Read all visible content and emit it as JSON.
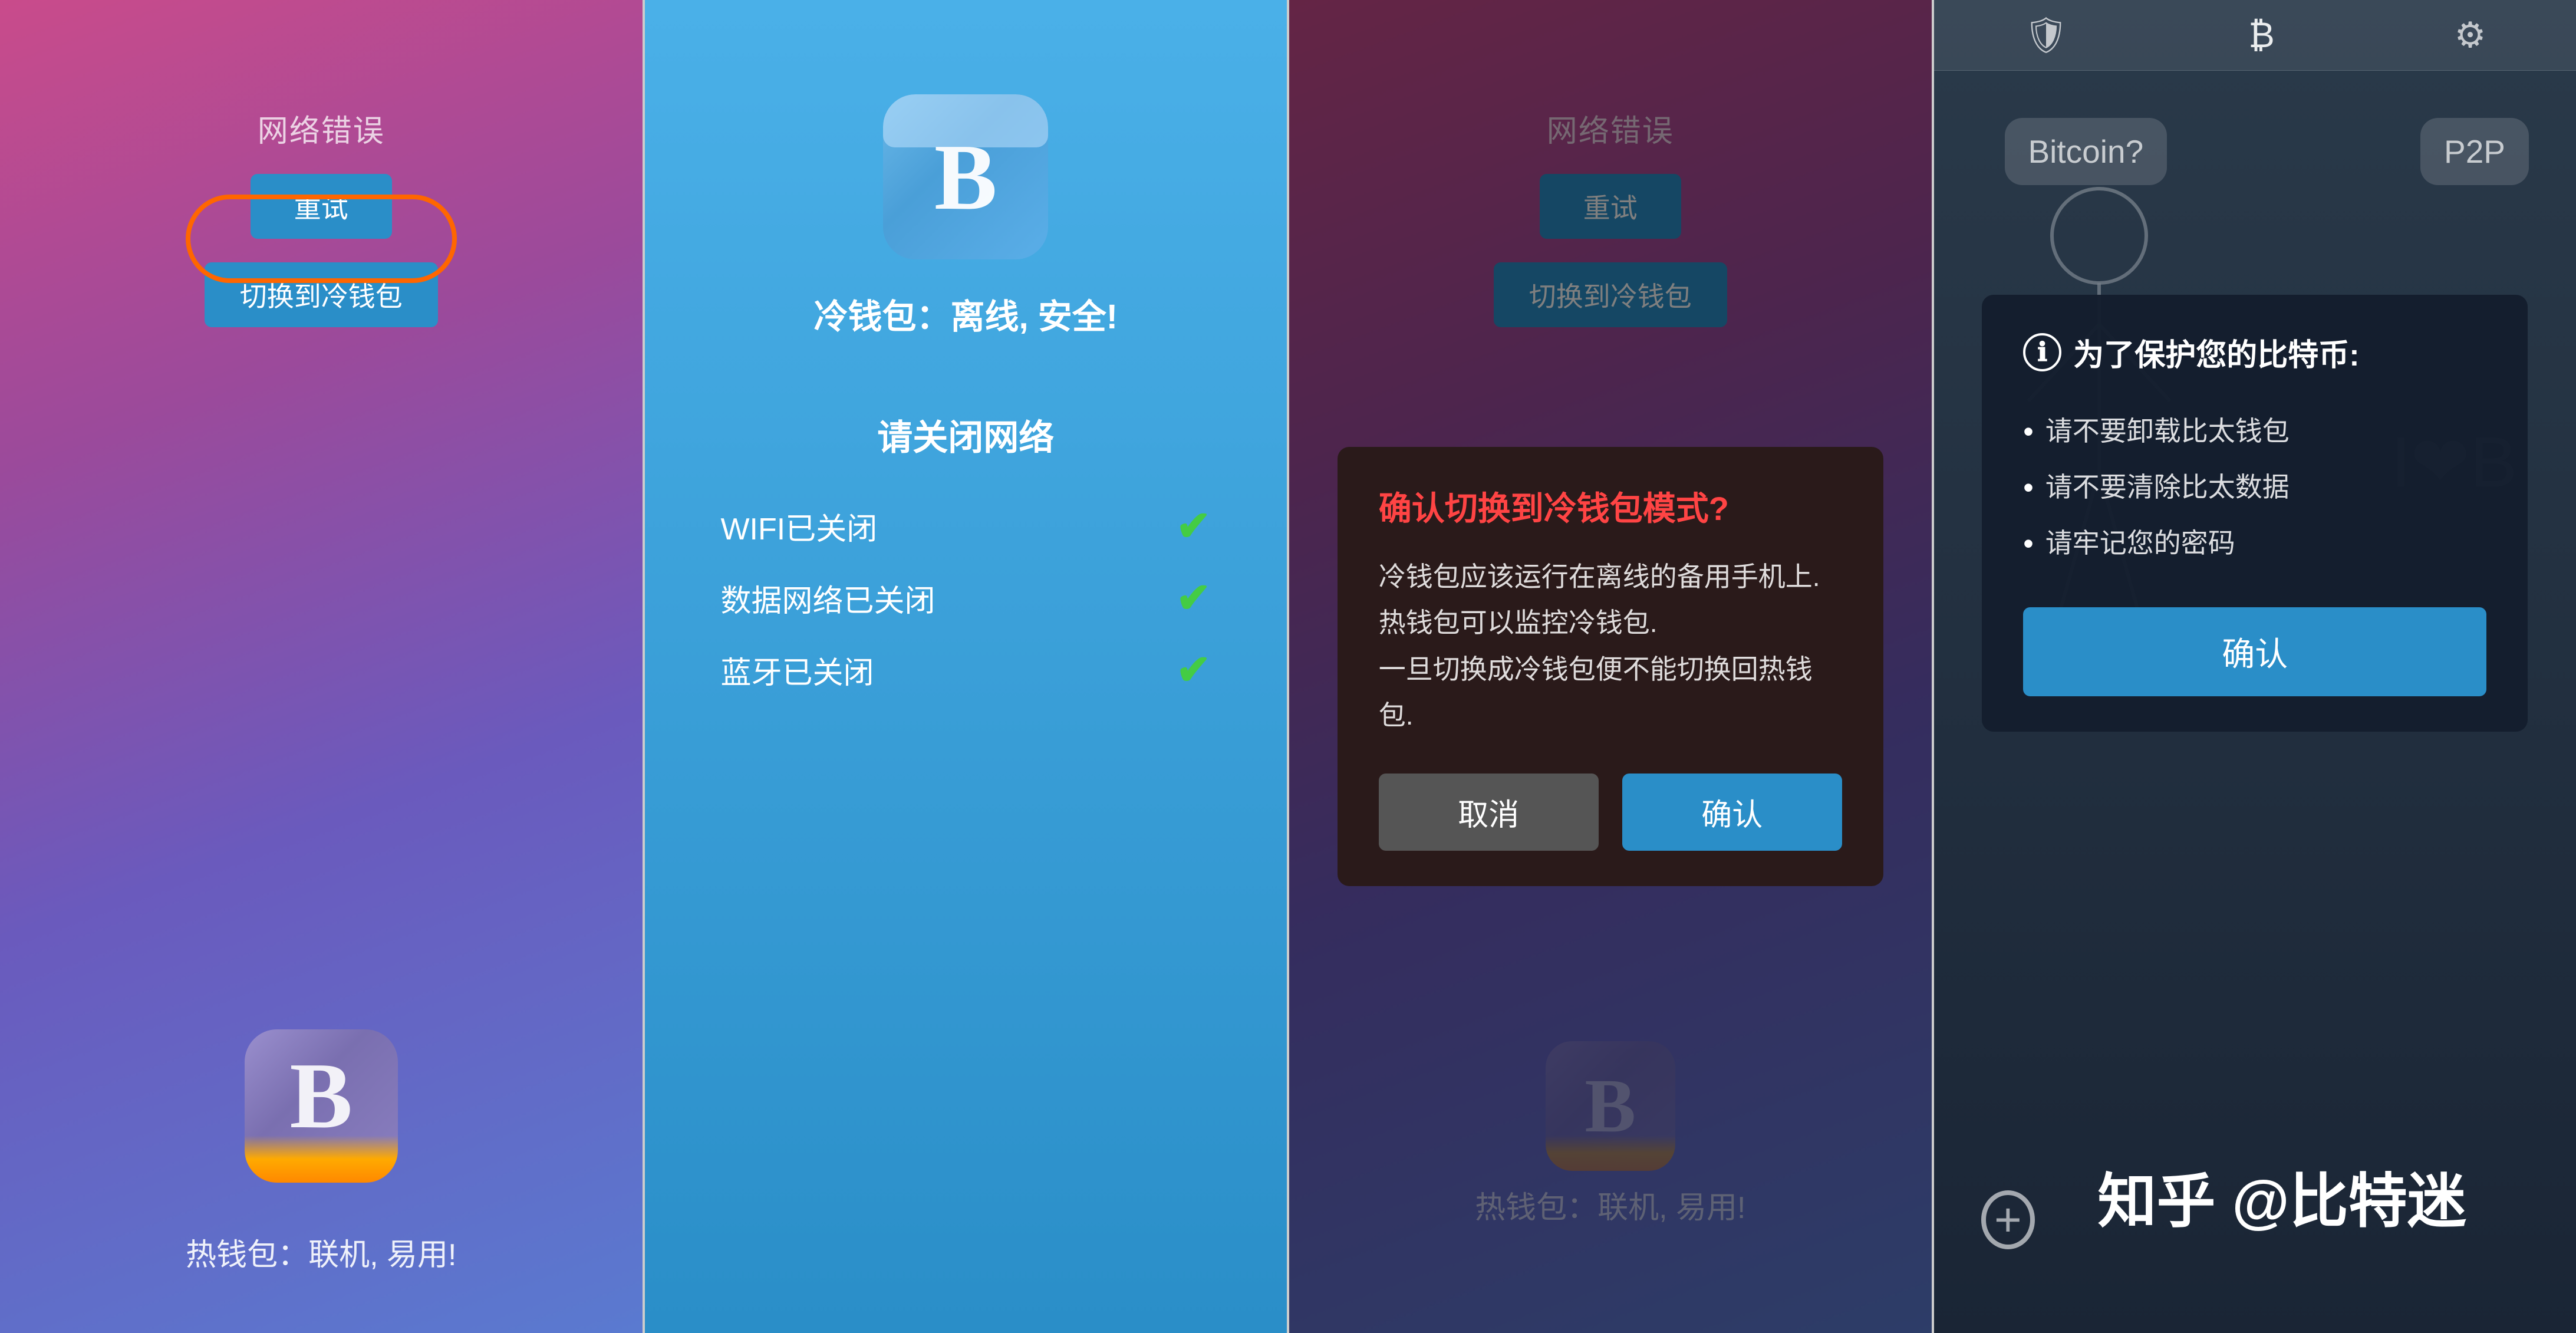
{
  "panel1": {
    "error_title": "网络错误",
    "btn_retry": "重试",
    "btn_switch": "切换到冷钱包",
    "wallet_label": "热钱包：联机, 易用!",
    "btc_letter": "B"
  },
  "panel2": {
    "cold_title": "冷钱包：离线, 安全!",
    "network_section_title": "请关闭网络",
    "network_rows": [
      {
        "label": "WIFI已关闭",
        "checked": true
      },
      {
        "label": "数据网络已关闭",
        "checked": true
      },
      {
        "label": "蓝牙已关闭",
        "checked": true
      }
    ],
    "btc_letter": "B"
  },
  "panel3": {
    "error_title": "网络错误",
    "btn_retry": "重试",
    "btn_switch": "切换到冷钱包",
    "wallet_label": "热钱包：联机, 易用!",
    "btc_letter": "B",
    "dialog": {
      "title": "确认切换到冷钱包模式?",
      "body": "冷钱包应该运行在离线的备用手机上.\n热钱包可以监控冷钱包.\n一旦切换成冷钱包便不能切换回热钱包.",
      "btn_cancel": "取消",
      "btn_confirm": "确认"
    }
  },
  "panel4": {
    "toolbar": {
      "shield_icon": "🛡",
      "btc_icon": "₿",
      "gear_icon": "⚙"
    },
    "speech_bubble_btc": "Bitcoin?",
    "speech_bubble_p2p": "P2P",
    "heart_btc": "I❤B",
    "dialog": {
      "info_icon": "ℹ",
      "title": "为了保护您的比特币:",
      "items": [
        "请不要卸载比太钱包",
        "请不要清除比太数据",
        "请牢记您的密码"
      ],
      "btn_confirm": "确认"
    },
    "footer_label": "知乎 @比特迷"
  }
}
